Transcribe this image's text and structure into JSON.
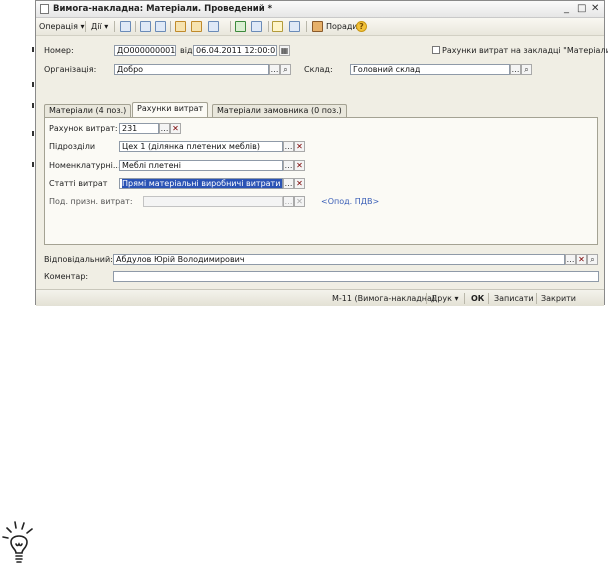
{
  "window": {
    "title": "Вимога-накладна: Матеріали. Проведений *",
    "controls": {
      "minimize": "_",
      "maximize": "□",
      "close": "✕"
    }
  },
  "toolbar": {
    "operation_label": "Операція ▾",
    "actions_label": "Дії ▾",
    "tips_label": "Поради",
    "help_glyph": "?"
  },
  "form": {
    "number_label": "Номер:",
    "number_value": "ДО000000001",
    "from_label": "від:",
    "date_value": "06.04.2011 12:00:01",
    "expense_accounts_checkbox_label": "Рахунки витрат на закладці \"Матеріали\"",
    "organization_label": "Організація:",
    "organization_value": "Добро",
    "warehouse_label": "Склад:",
    "warehouse_value": "Головний склад"
  },
  "tabs": [
    {
      "label": "Матеріали (4 поз.)"
    },
    {
      "label": "Рахунки витрат"
    },
    {
      "label": "Матеріали замовника (0 поз.)"
    }
  ],
  "expense_tab": {
    "account_label": "Рахунок витрат:",
    "account_value": "231",
    "division_label": "Підрозділи",
    "division_value": "Цех 1 (ділянка плетених меблів)",
    "nomenclature_label": "Номенклатурні...",
    "nomenclature_value": "Меблі плетені",
    "cost_item_label": "Статті витрат",
    "cost_item_value": "Прямі матеріальні виробничі витрати крім",
    "tax_attr_label": "Под. призн. витрат:",
    "tax_attr_value": "",
    "vat_link": "<Опод. ПДВ>"
  },
  "footer": {
    "responsible_label": "Відповідальний:",
    "responsible_value": "Абдулов Юрій Володимирович",
    "comment_label": "Коментар:",
    "comment_value": ""
  },
  "status_bar": {
    "form_label": "М-11 (Вимога-накладна)",
    "print_label": "Друк ▾",
    "ok_label": "ОК",
    "save_label": "Записати",
    "close_label": "Закрити"
  },
  "icons": [
    "document-icon",
    "select-icon",
    "clear-icon",
    "search-icon",
    "calendar-icon",
    "lightbulb-icon"
  ],
  "colors": {
    "selection": "#2a53b5",
    "link": "#3b5fb7",
    "window_bg": "#f0eee4"
  }
}
